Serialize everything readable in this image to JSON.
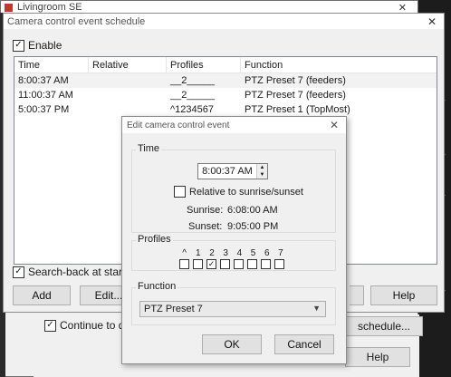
{
  "background_window": {
    "title": "Livingroom SE",
    "continue_label": "Continue to displa",
    "schedule_button": "schedule...",
    "help_button": "Help"
  },
  "schedule_dialog": {
    "title": "Camera control event schedule",
    "enable_label": "Enable",
    "enable_checked": true,
    "columns": [
      "Time",
      "Relative",
      "Profiles",
      "Function"
    ],
    "rows": [
      {
        "time": "8:00:37 AM",
        "relative": "",
        "profiles": "__2_____",
        "function": "PTZ Preset  7 (feeders)"
      },
      {
        "time": "11:00:37 AM",
        "relative": "",
        "profiles": "__2_____",
        "function": "PTZ Preset  7 (feeders)"
      },
      {
        "time": "5:00:37 PM",
        "relative": "",
        "profiles": "^1234567",
        "function": "PTZ Preset  1 (TopMost)"
      }
    ],
    "search_back_label": "Search-back at startup/res",
    "search_back_checked": true,
    "add_button": "Add",
    "edit_button": "Edit...",
    "help_button": "Help"
  },
  "edit_dialog": {
    "title": "Edit camera control event",
    "time_group": "Time",
    "time_value": "8:00:37 AM",
    "relative_label": "Relative to sunrise/sunset",
    "relative_checked": false,
    "sunrise_label": "Sunrise:",
    "sunrise_value": "6:08:00 AM",
    "sunset_label": "Sunset:",
    "sunset_value": "9:05:00 PM",
    "profiles_group": "Profiles",
    "profile_labels": [
      "^",
      "1",
      "2",
      "3",
      "4",
      "5",
      "6",
      "7"
    ],
    "profile_checked": [
      false,
      false,
      true,
      false,
      false,
      false,
      false,
      false
    ],
    "function_group": "Function",
    "function_value": "PTZ Preset  7",
    "ok_button": "OK",
    "cancel_button": "Cancel"
  }
}
